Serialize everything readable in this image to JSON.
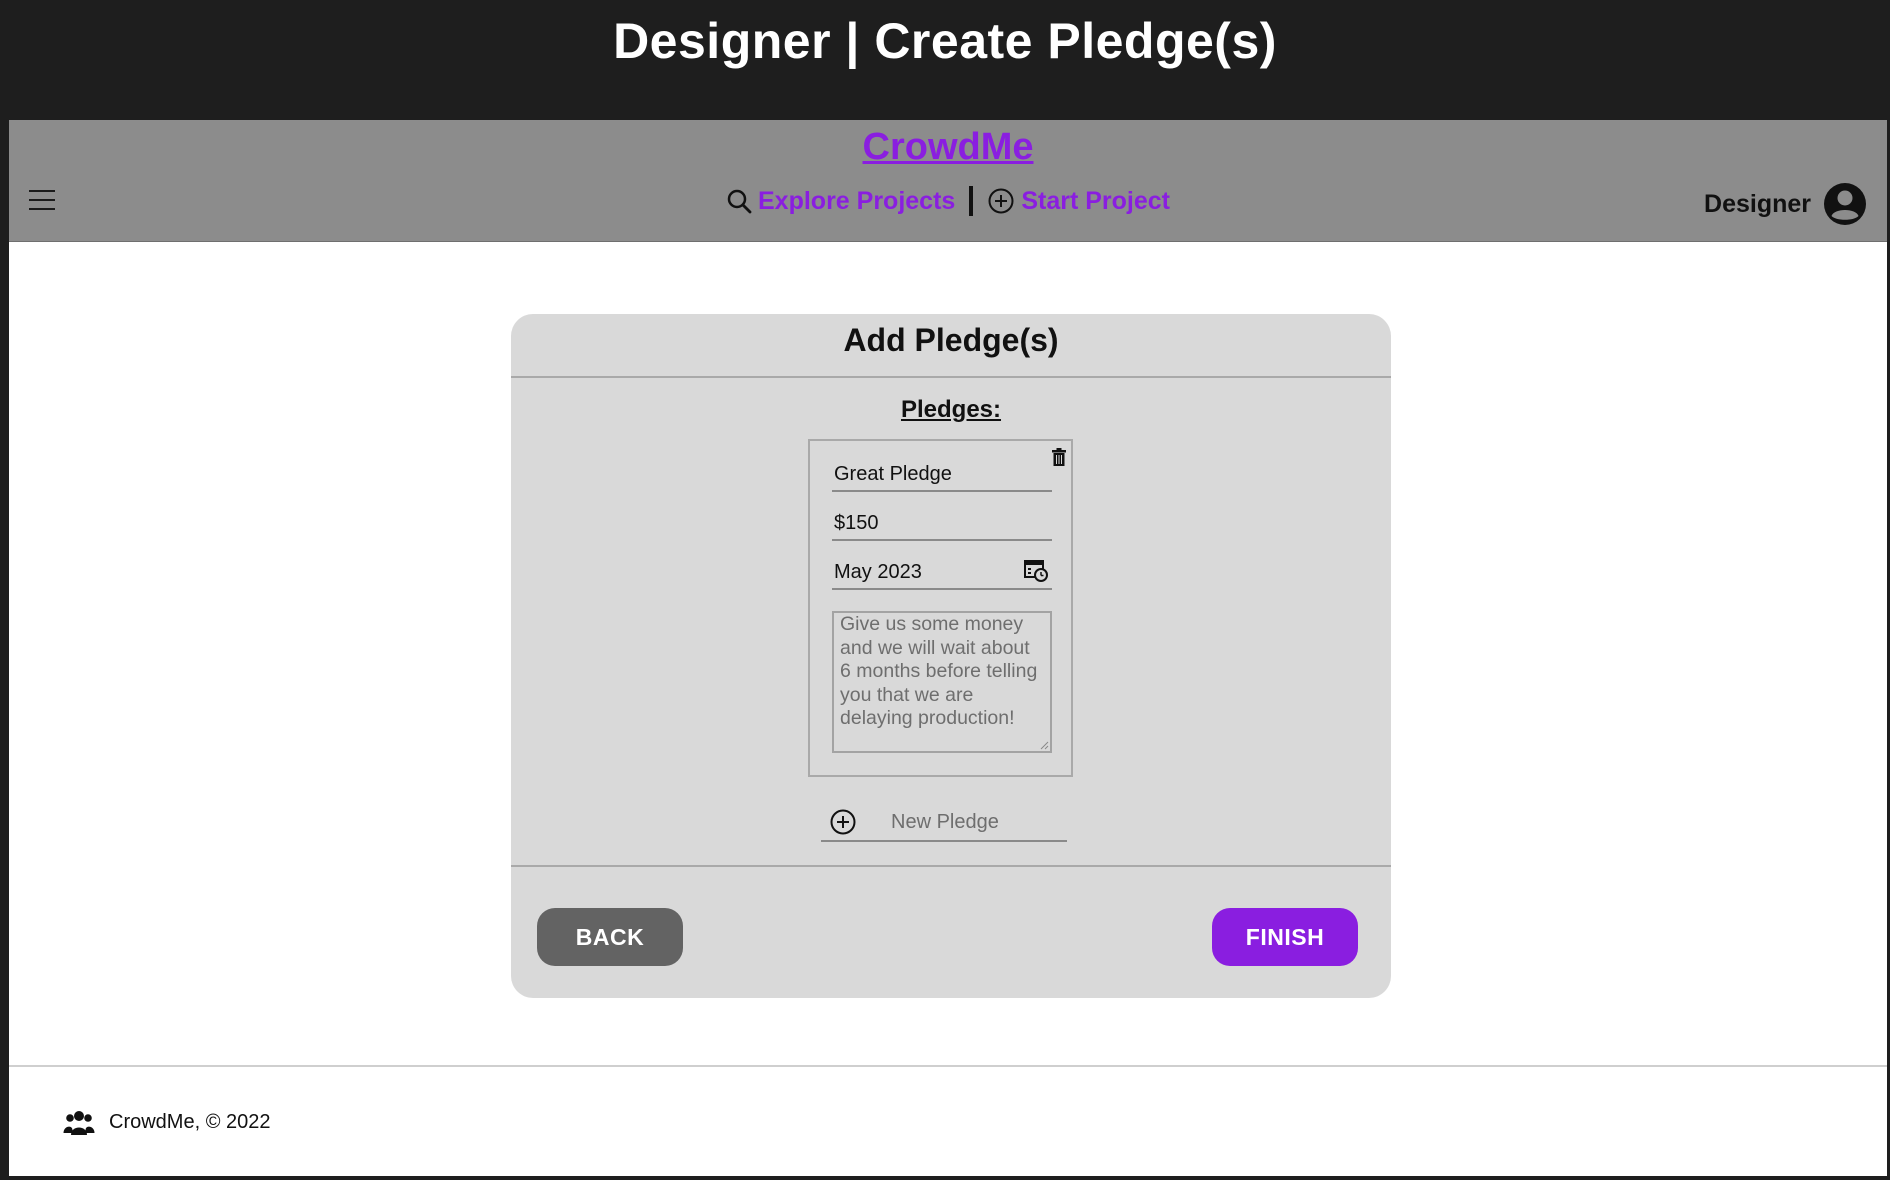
{
  "window_title": "Designer | Create Pledge(s)",
  "navbar": {
    "brand": "CrowdMe",
    "explore_label": "Explore Projects",
    "start_label": "Start Project",
    "user_label": "Designer",
    "accent_color": "#8a1ee0"
  },
  "card": {
    "title": "Add Pledge(s)",
    "pledges_label": "Pledges:",
    "pledge": {
      "name": "Great Pledge",
      "amount": "$150",
      "date": "May 2023",
      "description": "Give us some money and we will wait about 6 months before telling you that we are delaying production!"
    },
    "new_pledge_label": "New Pledge",
    "back_label": "BACK",
    "finish_label": "FINISH"
  },
  "footer": {
    "text": "CrowdMe, © 2022"
  },
  "icons": {
    "menu": "hamburger-icon",
    "search": "search-icon",
    "add": "plus-circle-icon",
    "user": "user-avatar-icon",
    "trash": "trash-icon",
    "calendar": "calendar-icon",
    "footer_logo": "people-group-icon"
  }
}
